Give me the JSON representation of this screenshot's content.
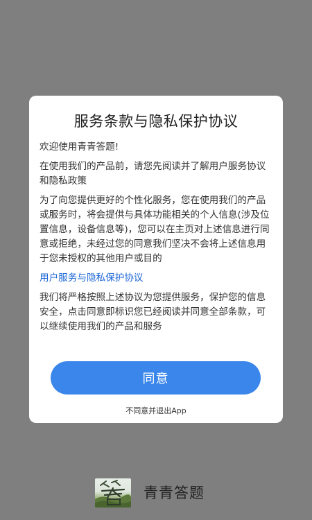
{
  "dialog": {
    "title": "服务条款与隐私保护协议",
    "paragraphs": [
      "欢迎使用青青答题!",
      "在使用我们的产品前，请您先阅读并了解用户服务协议和隐私政策",
      "为了向您提供更好的个性化服务，您在使用我们的产品或服务时，将会提供与具体功能相关的个人信息(涉及位置信息，设备信息等)，您可以在主页对上述信息进行同意或拒绝，未经过您的同意我们坚决不会将上述信息用于您未授权的其他用户或目的"
    ],
    "policy_link": "用户服务与隐私保护协议",
    "closing": "我们将严格按照上述协议为您提供服务，保护您的信息安全，点击同意即标识您已经阅读并同意全部条款，可以继续使用我们的产品和服务",
    "agree_label": "同意",
    "decline_label": "不同意并退出App"
  },
  "brand": {
    "app_name": "青青答题",
    "logo_icon": "qingqing-dati-logo-icon"
  },
  "colors": {
    "overlay": "#7f7f7f",
    "dialog_bg": "#ffffff",
    "accent": "#3a86ea",
    "link": "#1b66d6"
  }
}
